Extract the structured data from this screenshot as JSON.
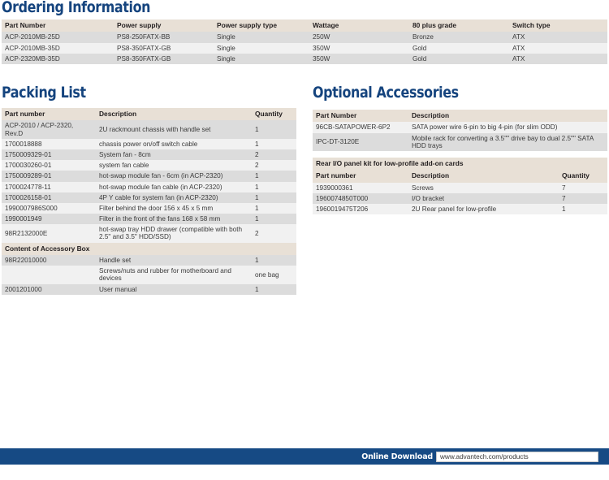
{
  "sections": {
    "ordering": {
      "title": "Ordering Information",
      "columns": [
        "Part Number",
        "Power supply",
        "Power supply type",
        "Wattage",
        "80 plus grade",
        "Switch type"
      ],
      "rows": [
        [
          "ACP-2010MB-25D",
          "PS8-250FATX-BB",
          "Single",
          "250W",
          "Bronze",
          "ATX"
        ],
        [
          "ACP-2010MB-35D",
          "PS8-350FATX-GB",
          "Single",
          "350W",
          "Gold",
          "ATX"
        ],
        [
          "ACP-2320MB-35D",
          "PS8-350FATX-GB",
          "Single",
          "350W",
          "Gold",
          "ATX"
        ]
      ]
    },
    "packing": {
      "title": "Packing List",
      "columns": [
        "Part number",
        "Description",
        "Quantity"
      ],
      "rows": [
        [
          "ACP-2010 / ACP-2320, Rev.D",
          "2U rackmount chassis with handle set",
          "1"
        ],
        [
          "1700018888",
          "chassis power on/off switch cable",
          "1"
        ],
        [
          "1750009329-01",
          "System fan - 8cm",
          "2"
        ],
        [
          "1700030260-01",
          "system fan cable",
          "2"
        ],
        [
          "1750009289-01",
          "hot-swap module fan - 6cm (in ACP-2320)",
          "1"
        ],
        [
          "1700024778-11",
          "hot-swap module fan cable (in ACP-2320)",
          "1"
        ],
        [
          "1700026158-01",
          "4P Y cable for system fan (in ACP-2320)",
          "1"
        ],
        [
          "1990007986S000",
          "Filter behind the door 156 x 45 x 5 mm",
          "1"
        ],
        [
          "1990001949",
          "Filter in the front of the fans 168 x 58 mm",
          "1"
        ],
        [
          "98R2132000E",
          "hot-swap tray HDD drawer (compatible with both 2.5\" and 3.5\" HDD/SSD)",
          "2"
        ]
      ],
      "subheading": "Content of Accessory Box",
      "accessory_rows": [
        [
          "98R22010000",
          "Handle set",
          "1"
        ],
        [
          "",
          "Screws/nuts and rubber for motherboard and devices",
          "one bag"
        ],
        [
          "2001201000",
          "User manual",
          "1"
        ]
      ]
    },
    "optional": {
      "title": "Optional Accessories",
      "columns": [
        "Part Number",
        "Description"
      ],
      "rows": [
        [
          "96CB-SATAPOWER-6P2",
          "SATA power wire 6-pin to big 4-pin (for slim ODD)"
        ],
        [
          "IPC-DT-3120E",
          "Mobile rack for converting a 3.5\"\" drive bay to dual 2.5\"\" SATA HDD trays"
        ]
      ],
      "rear_kit": {
        "subheading": "Rear I/O panel kit for low-profile add-on cards",
        "columns": [
          "Part number",
          "Description",
          "Quantity"
        ],
        "rows": [
          [
            "1939000361",
            "Screws",
            "7"
          ],
          [
            "1960074850T000",
            "I/O bracket",
            "7"
          ],
          [
            "1960019475T206",
            "2U Rear panel for low-profile",
            "1"
          ]
        ]
      }
    }
  },
  "footer": {
    "label": "Online Download",
    "url": "www.advantech.com/products"
  },
  "colors": {
    "heading_blue": "#15447e",
    "footer_bar": "#164a84",
    "table_header_beige": "#e8e0d6",
    "row_gray": "#dcdcdc",
    "row_light": "#f1f1f1"
  }
}
